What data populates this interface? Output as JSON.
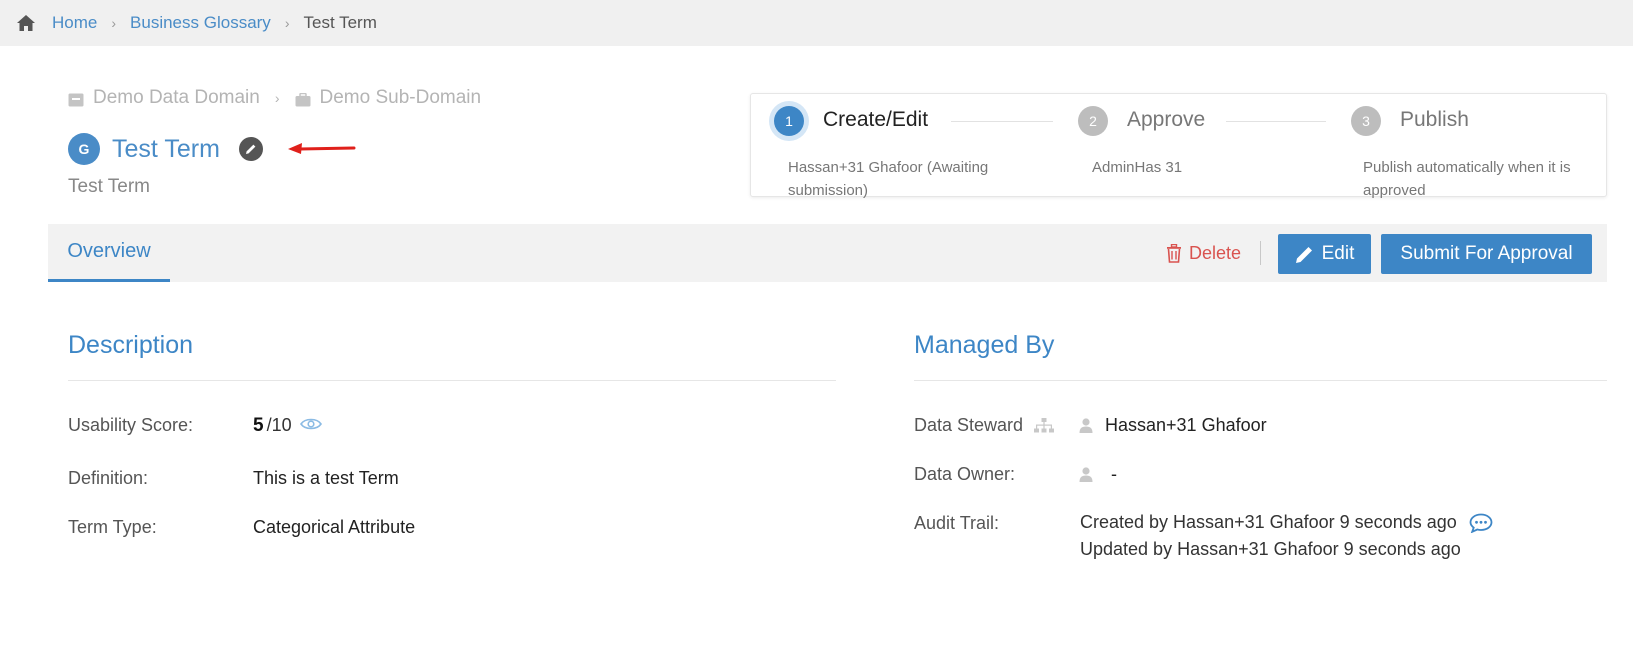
{
  "breadcrumb": {
    "home_icon": "home-icon",
    "items": [
      {
        "label": "Home"
      },
      {
        "label": "Business Glossary"
      }
    ],
    "current": "Test Term",
    "separator": "›"
  },
  "domain_path": {
    "domain": "Demo Data Domain",
    "subdomain": "Demo Sub-Domain",
    "separator": "›"
  },
  "term": {
    "badge": "G",
    "title": "Test Term",
    "subtitle": "Test Term"
  },
  "workflow": {
    "steps": [
      {
        "number": "1",
        "label": "Create/Edit",
        "desc_line1": "Hassan+31 Ghafoor (Awaiting",
        "desc_line2": "submission)",
        "state": "active"
      },
      {
        "number": "2",
        "label": "Approve",
        "desc_line1": "AdminHas 31",
        "desc_line2": "",
        "state": "inactive"
      },
      {
        "number": "3",
        "label": "Publish",
        "desc_line1": "Publish automatically when it is",
        "desc_line2": "approved",
        "state": "inactive"
      }
    ]
  },
  "tabs": {
    "overview": "Overview"
  },
  "actions": {
    "delete": "Delete",
    "edit": "Edit",
    "submit": "Submit For Approval"
  },
  "description": {
    "title": "Description",
    "usability_label": "Usability Score:",
    "usability_score": "5",
    "usability_max": "/10",
    "definition_label": "Definition:",
    "definition_value": "This is a test Term",
    "term_type_label": "Term Type:",
    "term_type_value": "Categorical Attribute"
  },
  "managed_by": {
    "title": "Managed By",
    "steward_label": "Data Steward",
    "steward_value": "Hassan+31 Ghafoor",
    "owner_label": "Data Owner:",
    "owner_value": "-",
    "audit_label": "Audit Trail:",
    "audit_created": "Created by Hassan+31 Ghafoor 9 seconds ago",
    "audit_updated": "Updated by Hassan+31 Ghafoor 9 seconds ago"
  },
  "colors": {
    "accent": "#3d86c6",
    "link": "#4a8cc7",
    "danger": "#d9534f",
    "annotation_arrow": "#e0201b"
  }
}
